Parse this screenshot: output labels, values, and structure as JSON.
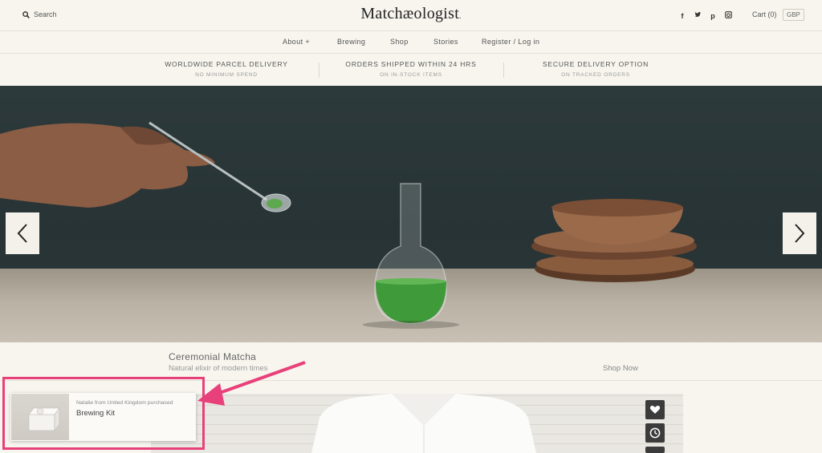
{
  "header": {
    "search_label": "Search",
    "logo": "Matchæologist",
    "logo_mark": ".",
    "social": [
      "f",
      "t",
      "p",
      "ig"
    ],
    "cart_label": "Cart (0)",
    "currency": "GBP"
  },
  "nav": {
    "items": [
      "About +",
      "Brewing",
      "Shop",
      "Stories",
      "Register / Log in"
    ]
  },
  "info_strip": [
    {
      "title": "WORLDWIDE PARCEL DELIVERY",
      "subtitle": "NO MINIMUM SPEND"
    },
    {
      "title": "ORDERS SHIPPED WITHIN 24 HRS",
      "subtitle": "ON IN-STOCK ITEMS"
    },
    {
      "title": "SECURE DELIVERY OPTION",
      "subtitle": "ON TRACKED ORDERS"
    }
  ],
  "hero": {
    "caption_title": "Ceremonial Matcha",
    "caption_subtitle": "Natural elixir of modern times",
    "cta": "Shop Now"
  },
  "notification": {
    "text": "Natalie from United Kingdom purchased",
    "product": "Brewing Kit",
    "thumb_label": "Matchæologist"
  },
  "colors": {
    "background": "#f7f5ee",
    "hero_wall": "#2b3537",
    "matcha_green": "#3f9a3a",
    "highlight": "#e8407a"
  },
  "icons": [
    "search-icon",
    "facebook-icon",
    "twitter-icon",
    "pinterest-icon",
    "instagram-icon",
    "chevron-left-icon",
    "chevron-right-icon",
    "heart-icon",
    "clock-icon"
  ]
}
